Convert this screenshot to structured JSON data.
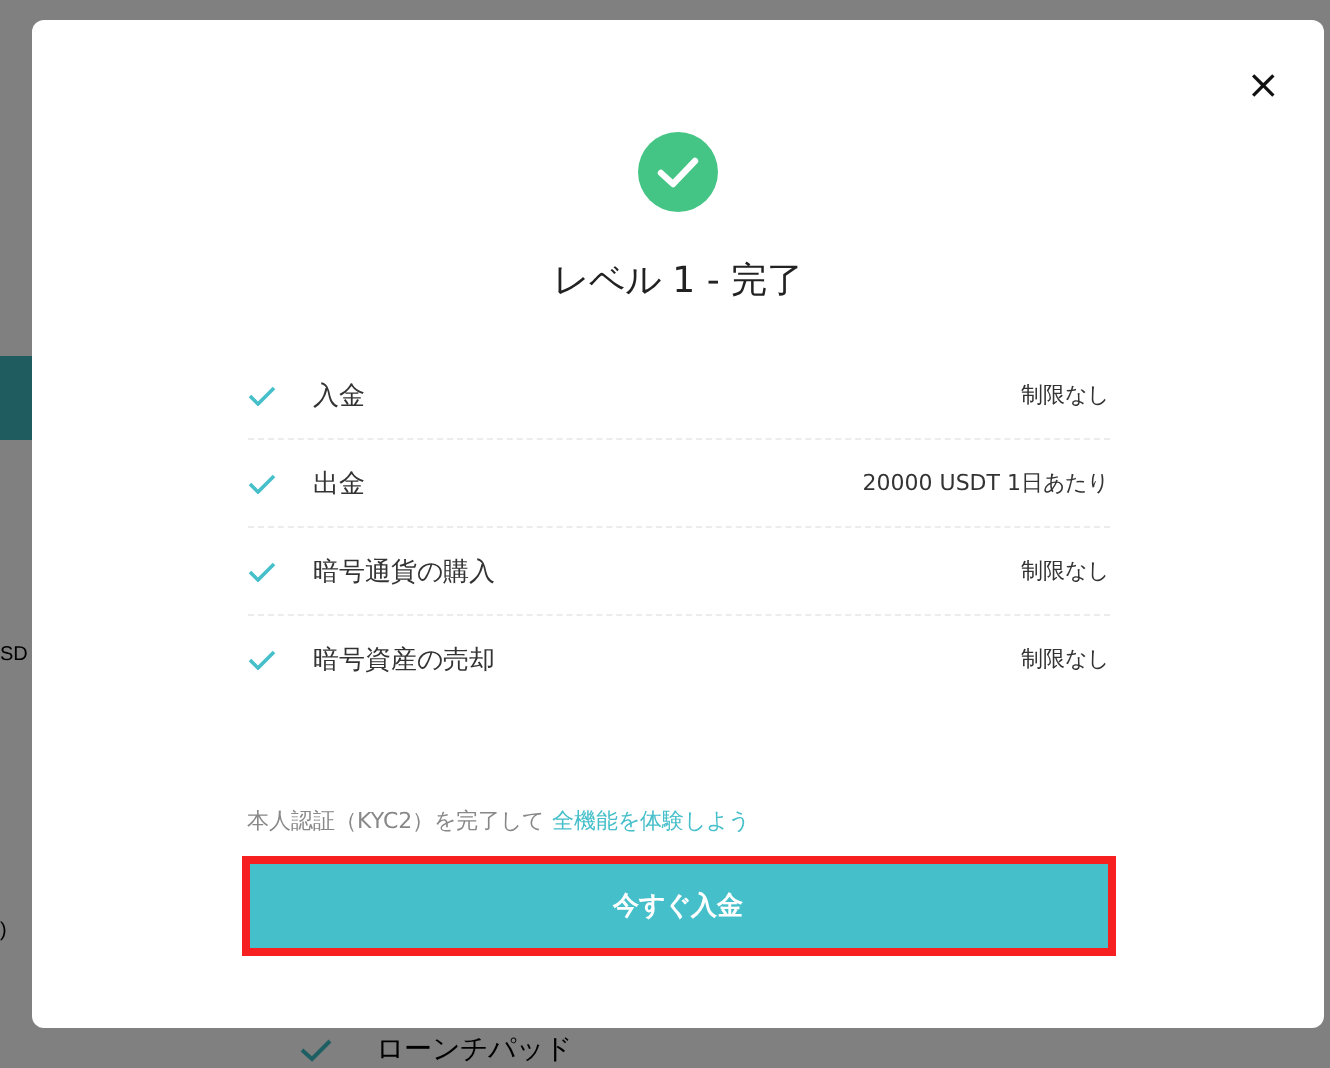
{
  "background_page": {
    "texts": [
      "SD",
      ")"
    ],
    "bottom_item": {
      "label": "ローンチパッド"
    }
  },
  "modal": {
    "close": "×",
    "title": "レベル 1 - 完了",
    "limits": [
      {
        "name": "入金",
        "limit": "制限なし"
      },
      {
        "name": "出金",
        "limit": "20000 USDT 1日あたり"
      },
      {
        "name": "暗号通貨の購入",
        "limit": "制限なし"
      },
      {
        "name": "暗号資産の売却",
        "limit": "制限なし"
      }
    ],
    "note": {
      "text": "本人認証（KYC2）を完了して",
      "link": "全機能を体験しよう"
    },
    "button": {
      "label": "今すぐ入金",
      "highlighted": true
    }
  }
}
